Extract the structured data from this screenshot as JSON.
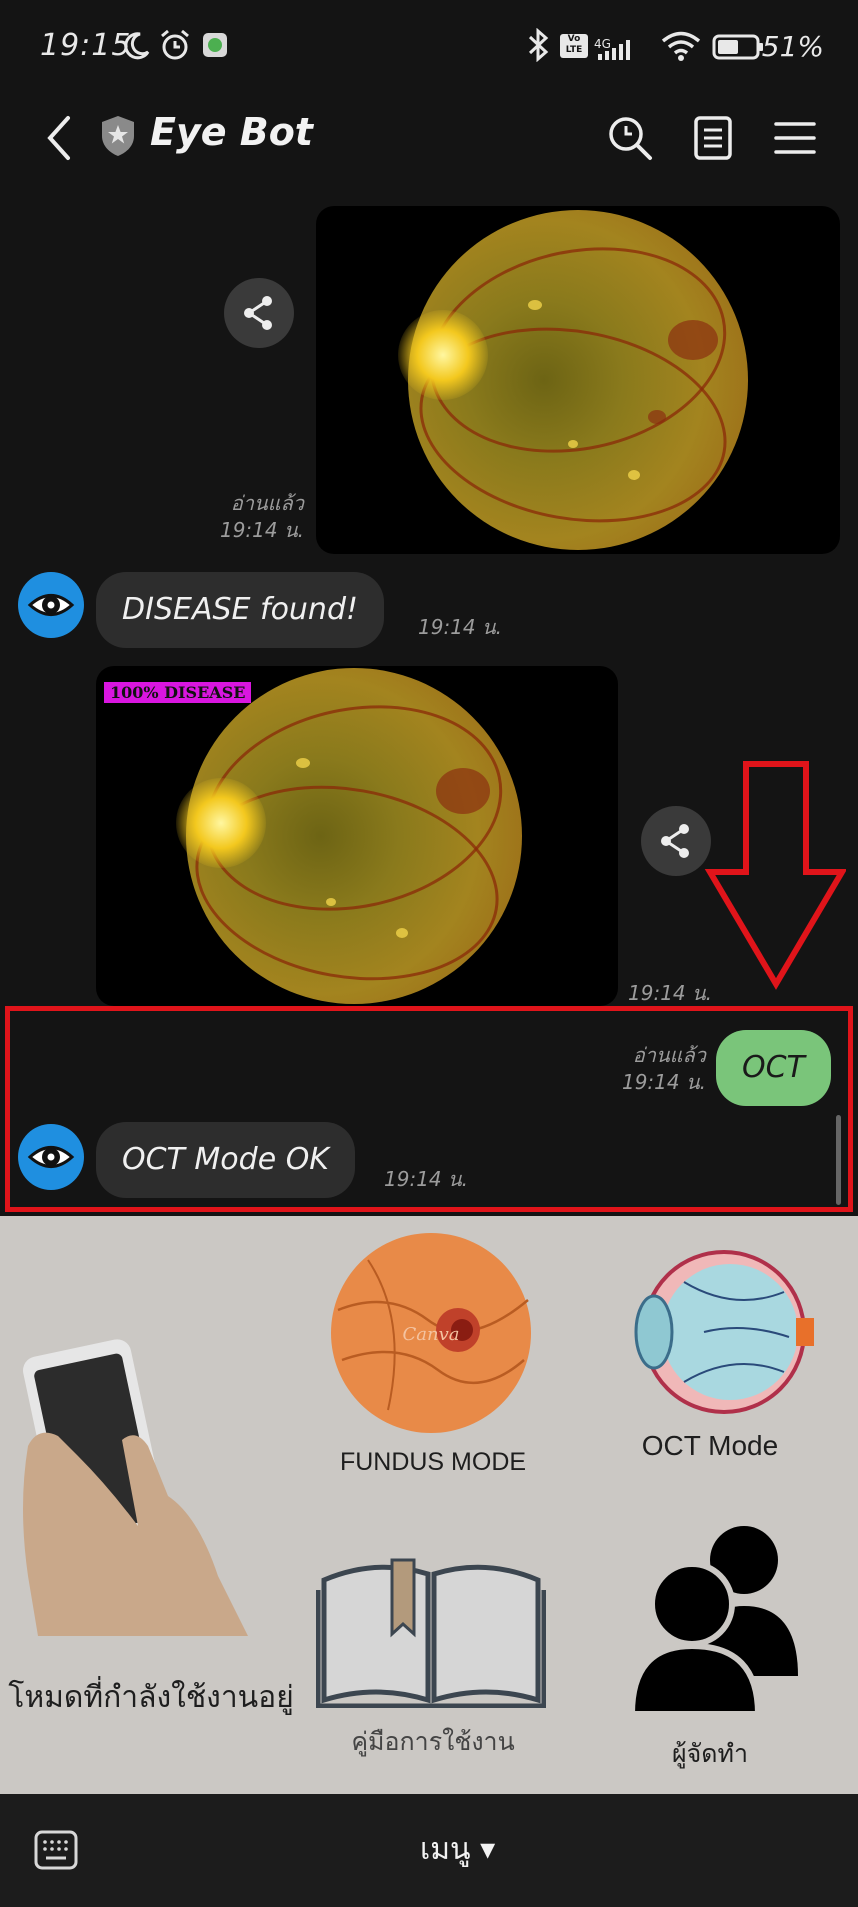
{
  "status_bar": {
    "time": "19:15",
    "network": "4G",
    "volte": "Vo LTE",
    "battery_text": "51%",
    "battery_level": 0.51
  },
  "header": {
    "title": "Eye Bot",
    "icons": [
      "back-arrow-icon",
      "shield-star-icon",
      "search-icon",
      "notes-icon",
      "menu-icon"
    ]
  },
  "chat": {
    "messages": [
      {
        "type": "user-image",
        "status": "อ่านแล้ว",
        "time": "19:14 น."
      },
      {
        "type": "bot-text",
        "text": "DISEASE found!",
        "time": "19:14 น."
      },
      {
        "type": "bot-image",
        "tag": "100% DISEASE",
        "time": "19:14 น."
      },
      {
        "type": "user-text",
        "text": "OCT",
        "status": "อ่านแล้ว",
        "time": "19:14 น."
      },
      {
        "type": "bot-text",
        "text": "OCT Mode OK",
        "time": "19:14 น."
      }
    ]
  },
  "rich_menu": {
    "current_mode_label": "โหมดที่กำลังใช้งานอยู่",
    "fundus_label": "FUNDUS MODE",
    "fundus_watermark": "Canva",
    "oct_label": "OCT Mode",
    "manual_label": "คู่มือการใช้งาน",
    "credits_label": "ผู้จัดทำ"
  },
  "bottom_bar": {
    "menu_label": "เมนู ▾"
  },
  "colors": {
    "accent_red": "#e0141a",
    "bot_avatar": "#1f8fe0",
    "user_bubble": "#7ac57a",
    "tag_magenta": "#d916e0"
  }
}
